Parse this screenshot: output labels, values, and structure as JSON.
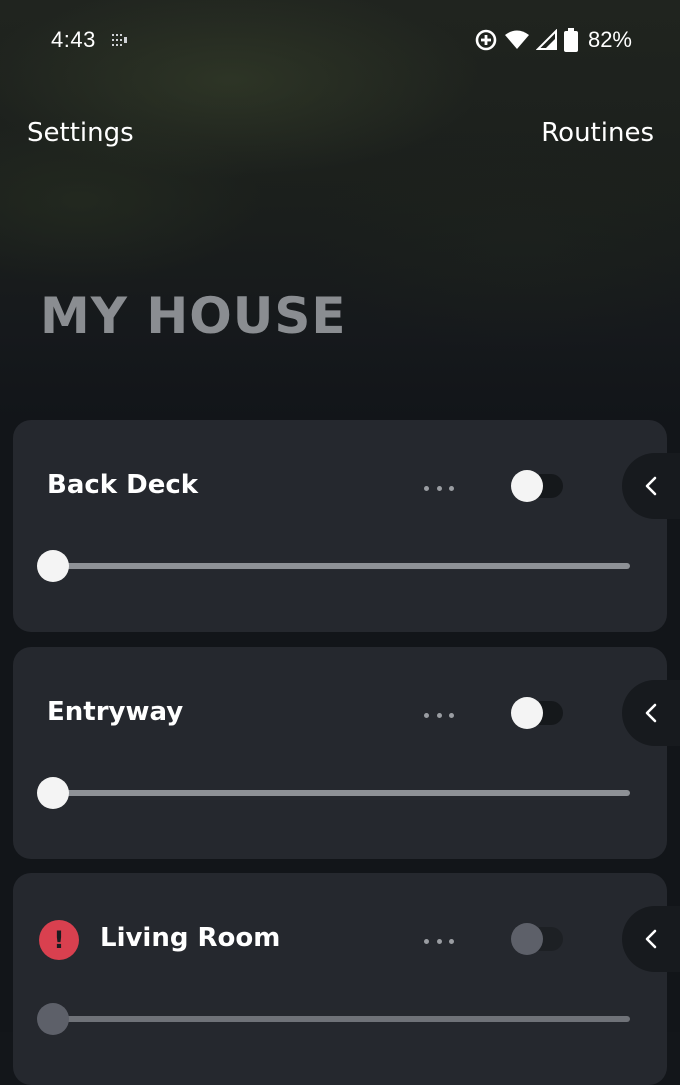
{
  "status_bar": {
    "time": "4:43",
    "battery_percent": "82%"
  },
  "header": {
    "settings_label": "Settings",
    "routines_label": "Routines"
  },
  "page_title": "MY HOUSE",
  "rooms": [
    {
      "name": "Back Deck",
      "has_alert": false,
      "power_on": false,
      "brightness": 0
    },
    {
      "name": "Entryway",
      "has_alert": false,
      "power_on": false,
      "brightness": 0
    },
    {
      "name": "Living Room",
      "has_alert": true,
      "alert_symbol": "!",
      "power_on": false,
      "brightness": 0,
      "disabled": true
    }
  ],
  "icons": {
    "more": "more-horizontal-icon",
    "expand": "chevron-left-icon",
    "alert": "alert-icon"
  },
  "colors": {
    "card_background": "#25282e",
    "title_gray": "#8a8d91",
    "alert_red": "#d9404f",
    "knob_white": "#f4f4f4"
  }
}
